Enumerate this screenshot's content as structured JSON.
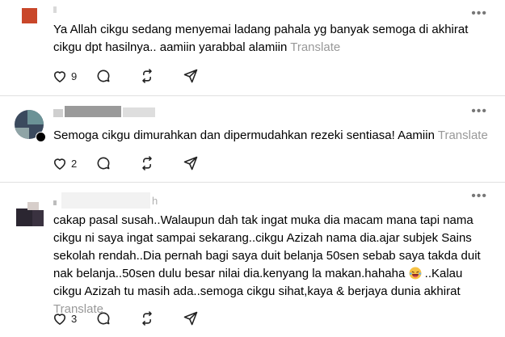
{
  "comments": [
    {
      "text": "Ya Allah cikgu sedang menyemai ladang pahala yg banyak semoga di akhirat cikgu dpt hasilnya.. aamiin yarabbal alamiin",
      "translate_label": "Translate",
      "like_count": "9",
      "avatar_color": "#c9472a"
    },
    {
      "text": "Semoga cikgu dimurahkan dan dipermudahkan rezeki sentiasa! Aamiin",
      "translate_label": "Translate",
      "like_count": "2",
      "avatar_colors": [
        "#3b4a5e",
        "#6b9296",
        "#ffffff"
      ]
    },
    {
      "meta_visible": "h",
      "text_part1": "cakap pasal susah..Walaupun dah tak ingat muka dia macam mana tapi nama cikgu ni saya ingat sampai sekarang..cikgu Azizah nama dia.ajar subjek Sains sekolah rendah..Dia pernah bagi saya duit belanja 50sen sebab saya takda duit nak belanja..50sen dulu besar nilai dia.kenyang la makan.hahaha",
      "emoji_name": "laughing-tear-emoji",
      "text_part2": "..Kalau cikgu Azizah tu masih ada..semoga cikgu sihat,kaya & berjaya dunia akhirat",
      "translate_label": "Translate",
      "like_count": "3",
      "avatar_colors": [
        "#2b2631",
        "#d7ceca"
      ]
    }
  ],
  "icons": [
    "heart-icon",
    "comment-icon",
    "repost-icon",
    "share-icon",
    "more-icon"
  ],
  "colors": {
    "text": "#000000",
    "translate": "#999999",
    "divider": "#e0e0e0"
  }
}
